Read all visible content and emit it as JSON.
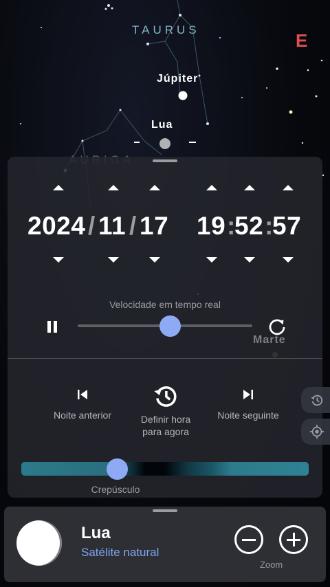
{
  "sky": {
    "constellations": [
      "TAURUS",
      "AURIGA"
    ],
    "objects": [
      "Júpiter",
      "Lua",
      "Marte"
    ],
    "compass_letter": "E"
  },
  "datetime": {
    "year": "2024",
    "month": "11",
    "day": "17",
    "hour": "19",
    "minute": "52",
    "second": "57",
    "date_separator": "/",
    "time_separator": ":"
  },
  "speed": {
    "label": "Velocidade em tempo real",
    "slider_fraction": 0.53
  },
  "night_nav": {
    "previous": "Noite anterior",
    "set_now": "Definir hora para agora",
    "next": "Noite seguinte"
  },
  "twilight": {
    "label": "Crepúsculo",
    "slider_fraction": 0.33
  },
  "selected_object": {
    "name": "Lua",
    "type": "Satélite natural",
    "zoom_label": "Zoom"
  },
  "colors": {
    "accent": "#8eaaf5",
    "subtitle": "#7fa6ef",
    "compass": "#e05050",
    "twilight_teal": "#2b7a8b"
  },
  "icons": [
    "pause-icon",
    "reset-speed-icon",
    "skip-previous-icon",
    "history-icon",
    "skip-next-icon",
    "history-side-icon",
    "locate-icon",
    "zoom-out-icon",
    "zoom-in-icon"
  ]
}
